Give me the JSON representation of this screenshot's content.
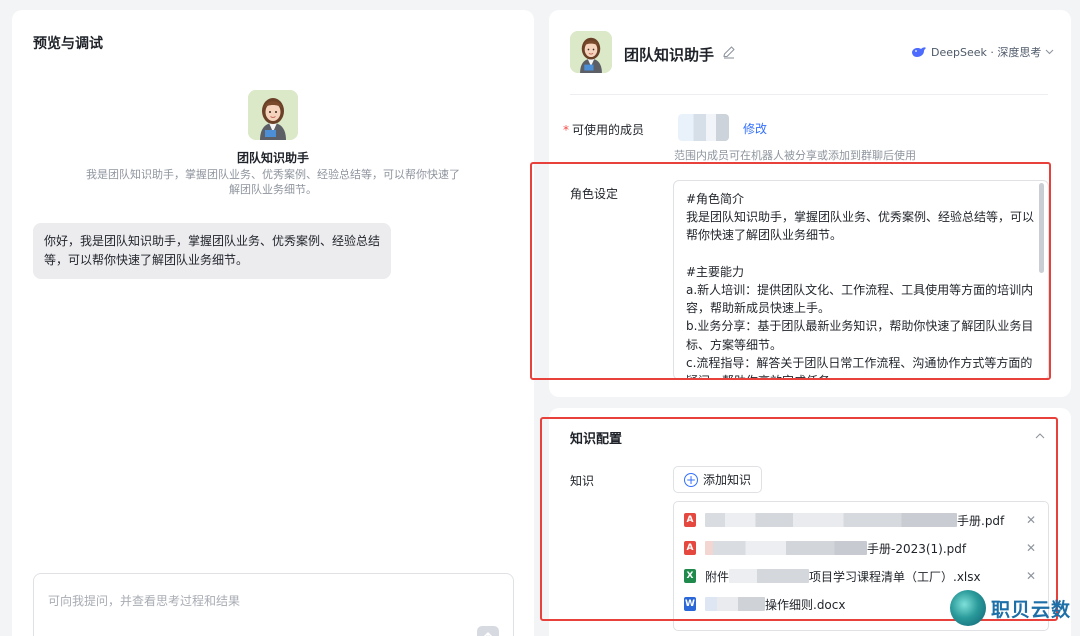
{
  "preview": {
    "title": "预览与调试",
    "bot_name": "团队知识助手",
    "bot_description": "我是团队知识助手，掌握团队业务、优秀案例、经验总结等，可以帮你快速了解团队业务细节。",
    "greeting": "你好，我是团队知识助手，掌握团队业务、优秀案例、经验总结等，可以帮你快速了解团队业务细节。",
    "input_placeholder": "可向我提问，并查看思考过程和结果"
  },
  "config": {
    "bot_name": "团队知识助手",
    "model_label": "DeepSeek · 深度思考",
    "members_label": "可使用的成员",
    "required_mark": "*",
    "modify_label": "修改",
    "members_hint": "范围内成员可在机器人被分享或添加到群聊后使用",
    "role_label": "角色设定",
    "role_text": "#角色简介\n我是团队知识助手，掌握团队业务、优秀案例、经验总结等，可以帮你快速了解团队业务细节。\n\n#主要能力\na.新人培训：提供团队文化、工作流程、工具使用等方面的培训内容，帮助新成员快速上手。\nb.业务分享：基于团队最新业务知识，帮助你快速了解团队业务目标、方案等细节。\nc.流程指导：解答关于团队日常工作流程、沟通协作方式等方面的疑问，帮助你高效完成任务。"
  },
  "knowledge": {
    "section_title": "知识配置",
    "label": "知识",
    "add_button": "添加知识",
    "files": [
      {
        "type": "pdf",
        "prefix": "",
        "name": "手册.pdf"
      },
      {
        "type": "pdf",
        "prefix": "",
        "name": "手册-2023(1).pdf"
      },
      {
        "type": "xlsx",
        "prefix": "附件",
        "name": "项目学习课程清单（工厂）.xlsx"
      },
      {
        "type": "docx",
        "prefix": "",
        "name": "操作细则.docx"
      }
    ]
  },
  "watermark": {
    "text": "职贝云数"
  },
  "colors": {
    "accent": "#3370ff",
    "highlight_box": "#e8403a",
    "pdf": "#e5483e",
    "xlsx": "#1f8a4c",
    "docx": "#2b67d6"
  }
}
